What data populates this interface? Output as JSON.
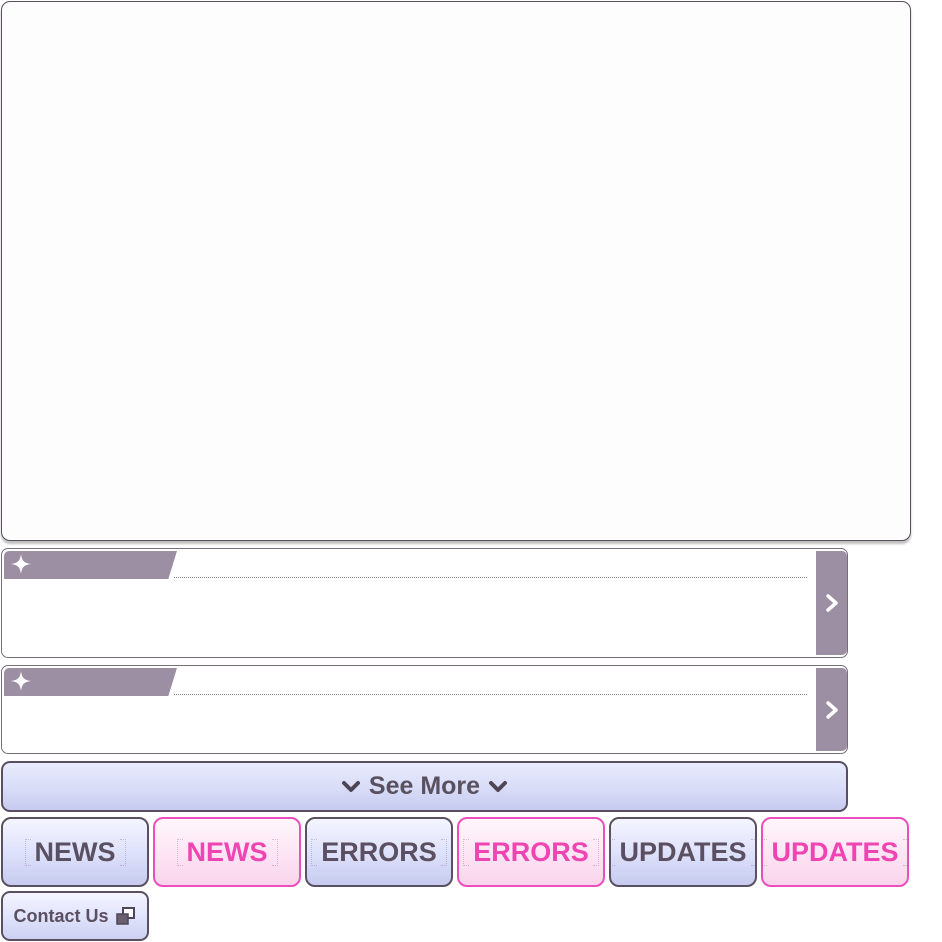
{
  "panel": {},
  "cards": [
    {
      "icon": "sparkle-icon",
      "action_icon": "chevron-right-icon"
    },
    {
      "icon": "sparkle-icon",
      "action_icon": "chevron-right-icon"
    }
  ],
  "see_more": {
    "label": "See More",
    "icon": "chevron-down-icon"
  },
  "nav_buttons": [
    {
      "label": "NEWS",
      "style": "gray"
    },
    {
      "label": "NEWS",
      "style": "pink"
    },
    {
      "label": "ERRORS",
      "style": "gray"
    },
    {
      "label": "ERRORS",
      "style": "pink"
    },
    {
      "label": "UPDATES",
      "style": "gray"
    },
    {
      "label": "UPDATES",
      "style": "pink"
    }
  ],
  "contact": {
    "label": "Contact Us",
    "icon": "external-window-icon"
  },
  "colors": {
    "accent_gray": "#9d8fa3",
    "text_dark": "#5b5061",
    "pink": "#ee45b2",
    "button_blue": "#d8dcf7"
  }
}
